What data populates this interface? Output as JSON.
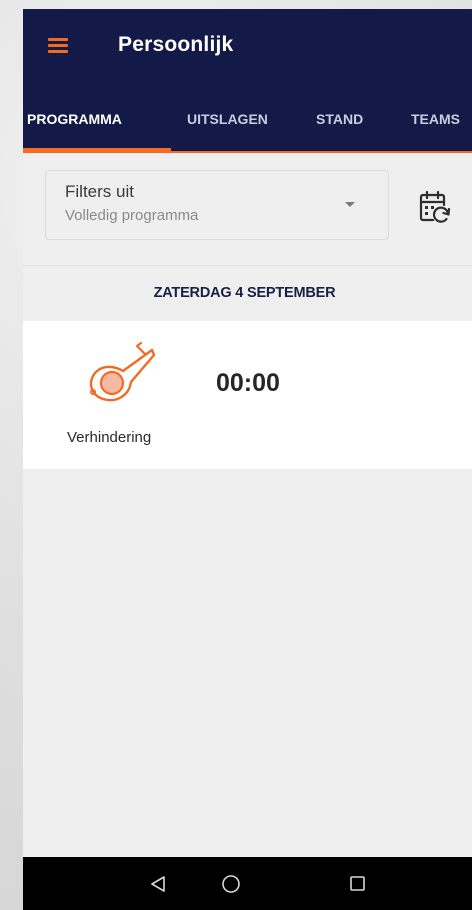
{
  "app": {
    "title": "Persoonlijk"
  },
  "tabs": [
    {
      "label": "PROGRAMMA",
      "active": true
    },
    {
      "label": "UITSLAGEN",
      "active": false
    },
    {
      "label": "STAND",
      "active": false
    },
    {
      "label": "TEAMS",
      "active": false
    }
  ],
  "filter": {
    "title": "Filters uit",
    "subtitle": "Volledig programma"
  },
  "schedule": {
    "date_header": "ZATERDAG 4 SEPTEMBER",
    "match": {
      "status_label": "Verhindering",
      "time": "00:00"
    }
  },
  "colors": {
    "appbar": "#141a48",
    "accent": "#f36a21",
    "background": "#efefef"
  },
  "icons": {
    "menu": "hamburger-menu-icon",
    "dropdown": "dropdown-caret-icon",
    "calendar": "calendar-refresh-icon",
    "whistle": "whistle-icon",
    "back": "nav-back-icon",
    "home": "nav-home-icon",
    "recent": "nav-recent-apps-icon"
  }
}
